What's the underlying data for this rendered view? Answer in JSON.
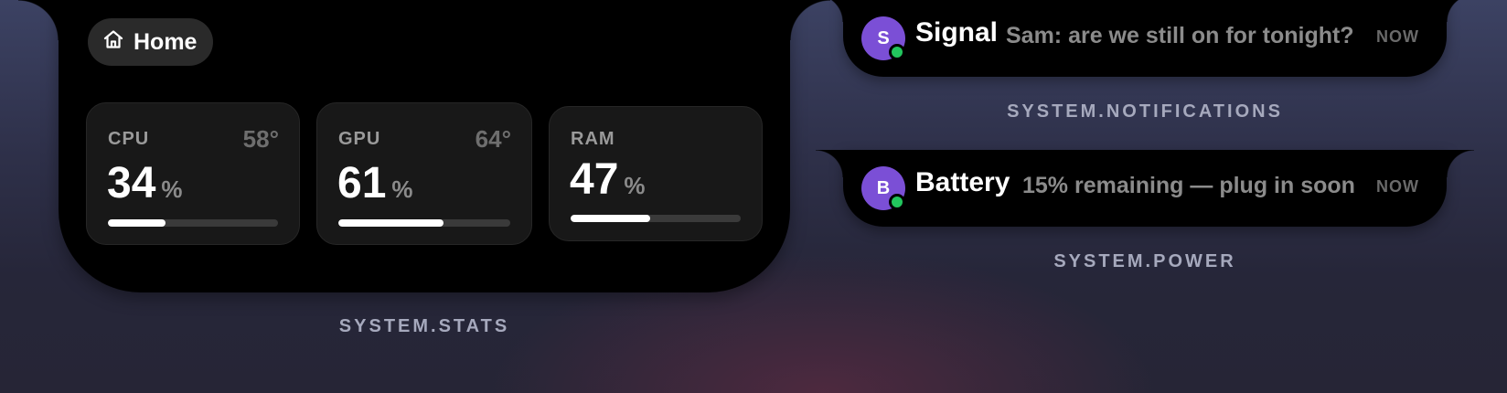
{
  "stats_widget": {
    "home_label": "Home",
    "home_icon": "home-icon",
    "cards": [
      {
        "label": "CPU",
        "temp": "58°",
        "value": "34",
        "unit": "%",
        "usage": 0.34
      },
      {
        "label": "GPU",
        "temp": "64°",
        "value": "61",
        "unit": "%",
        "usage": 0.61
      },
      {
        "label": "RAM",
        "temp": "",
        "value": "47",
        "unit": "%",
        "usage": 0.47
      }
    ],
    "caption": "SYSTEM.STATS"
  },
  "notifications": [
    {
      "avatar_letter": "S",
      "app": "Signal",
      "message": "Sam: are we still on for tonight?",
      "time": "NOW",
      "caption": "SYSTEM.NOTIFICATIONS"
    },
    {
      "avatar_letter": "B",
      "app": "Battery",
      "message": "15% remaining — plug in soon",
      "time": "NOW",
      "caption": "SYSTEM.POWER"
    }
  ],
  "colors": {
    "avatar": "#7b4fd6",
    "status_dot": "#22c55e",
    "panel": "#000000",
    "card": "#181818"
  }
}
